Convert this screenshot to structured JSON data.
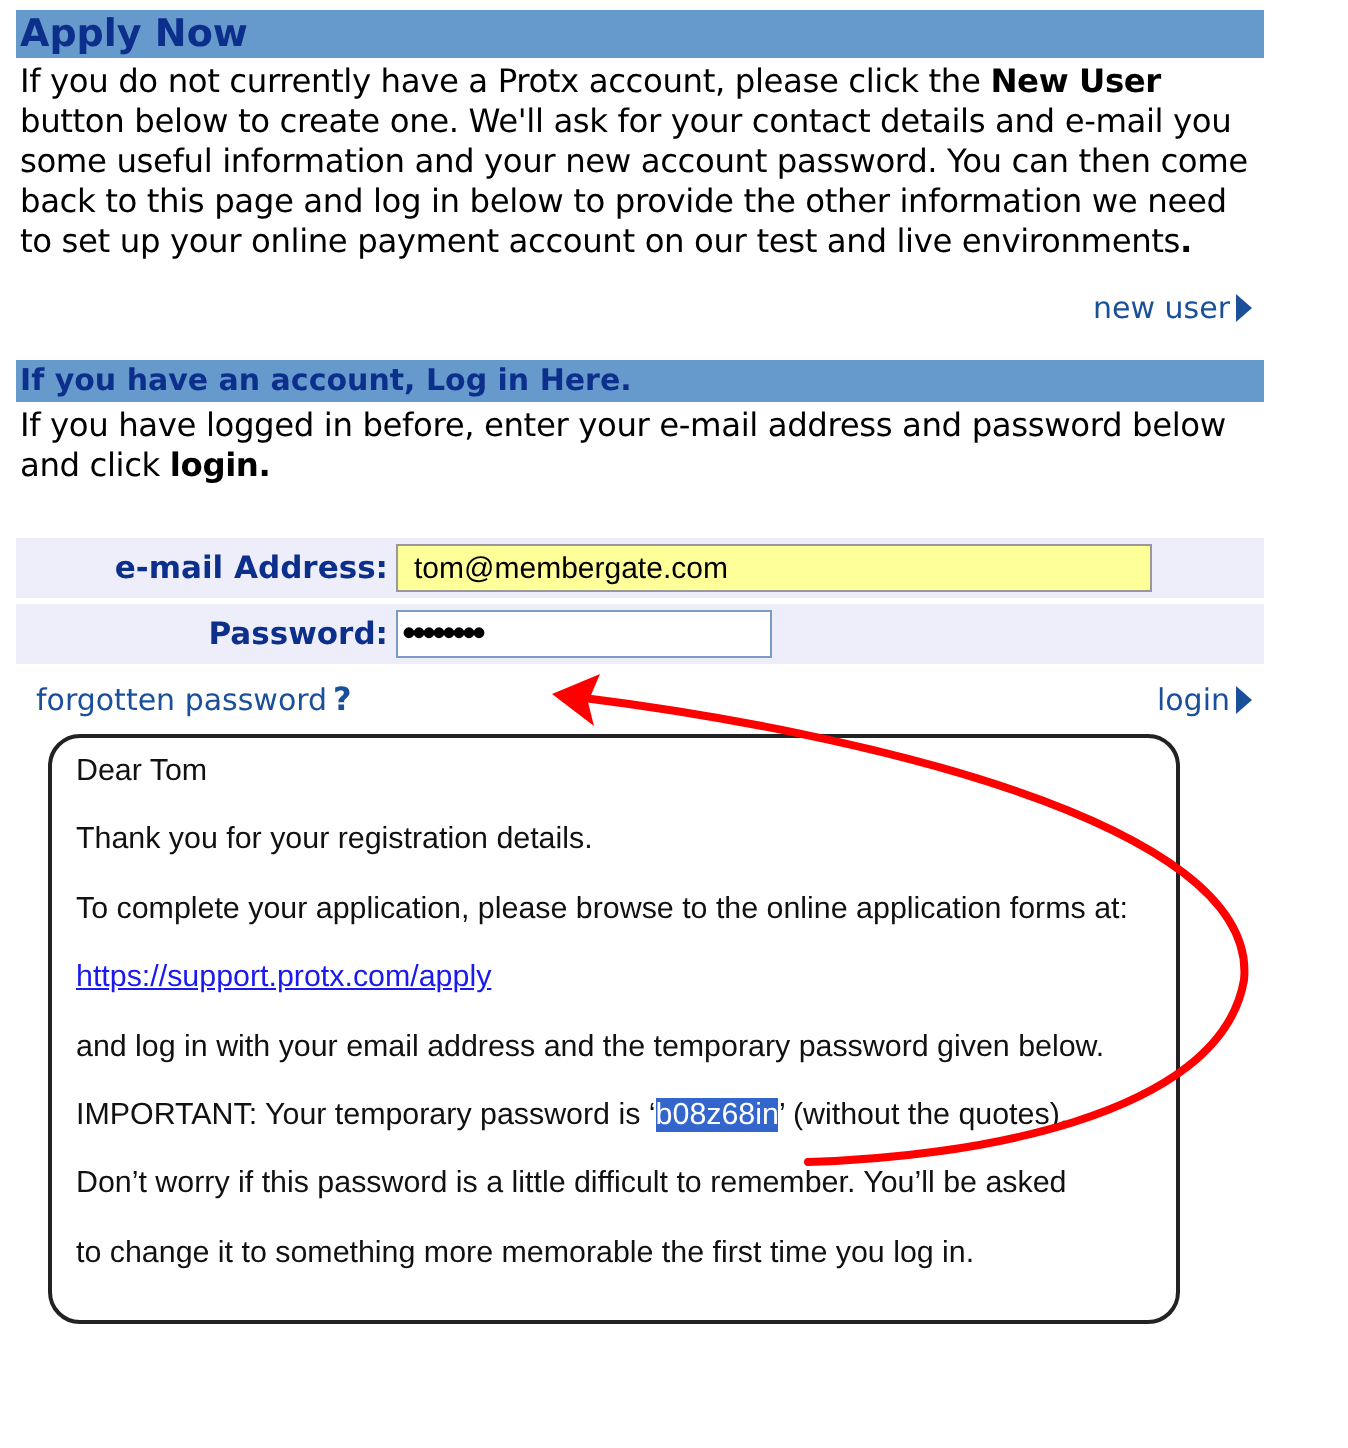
{
  "apply": {
    "heading": "Apply Now",
    "text": "If you do not currently have a Protx account, please click the **New User** button below to create one. We'll ask for your contact details and e-mail you some useful information and your new account password. You can then come back to this page and log in below to provide the other information we need to set up your online payment account on our test and live environments**.**",
    "link": "new user"
  },
  "login": {
    "heading": "If you have an account, Log in Here.",
    "text": "If you have logged in before, enter your e-mail address and password below and click **login.**",
    "fields": [
      {
        "label": "e-mail Address:",
        "value": "tom@membergate.com",
        "kind": "text"
      },
      {
        "label": "Password:",
        "value": "••••••••",
        "kind": "password"
      }
    ],
    "forgot_link": "forgotten password",
    "forgot_mark": "?",
    "login_link": "login"
  },
  "email": {
    "lines": [
      {
        "text": "Dear Tom",
        "kind": "text"
      },
      {
        "text": "Thank you for your registration details.",
        "kind": "text"
      },
      {
        "text": "To complete your application, please browse to the online application forms at:",
        "kind": "text"
      },
      {
        "text": "https://support.protx.com/apply",
        "kind": "link"
      },
      {
        "text": "and log in with your email address and the temporary password given below.",
        "kind": "text"
      },
      {
        "text": "IMPORTANT: Your temporary password is ‘",
        "highlight": "b08z68in",
        "after": "’ (without the quotes).",
        "kind": "highlight"
      },
      {
        "text": "Don’t worry if this password is a little difficult to remember. You’ll be asked",
        "kind": "text"
      },
      {
        "text": "to change it to something more memorable the first time you log in.",
        "kind": "text"
      }
    ]
  }
}
